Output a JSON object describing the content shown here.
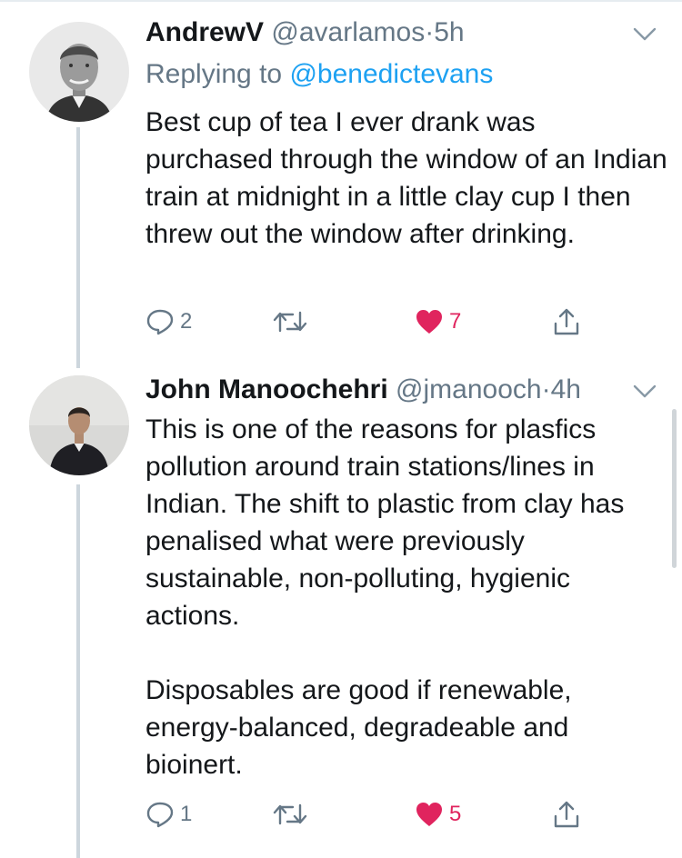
{
  "tweets": [
    {
      "display_name": "AndrewV",
      "handle": "@avarlamos",
      "separator": "·",
      "time": "5h",
      "replying_prefix": "Replying to ",
      "replying_to": "@benedictevans",
      "paragraphs": [
        "Best cup of tea I ever drank was purchased through the window of an Indian train at midnight in a little clay cup I then threw out the window after drinking."
      ],
      "replies": "2",
      "retweets": "",
      "likes": "7",
      "liked": true
    },
    {
      "display_name": "John Manoochehri",
      "handle": "@jmanooch",
      "separator": "·",
      "time": "4h",
      "paragraphs": [
        "This is one of the reasons for plasfics pollution around train stations/lines in Indian. The shift to plastic from clay has penalised what were previously sustainable, non-polluting, hygienic actions.",
        "Disposables are good if renewable, energy-balanced, degradeable and bioinert."
      ],
      "replies": "1",
      "retweets": "",
      "likes": "5",
      "liked": true
    }
  ],
  "icons": {
    "reply": "reply-icon",
    "retweet": "retweet-icon",
    "like": "heart-icon",
    "share": "share-icon",
    "more": "chevron-down-icon"
  },
  "colors": {
    "text": "#14171a",
    "secondary": "#657786",
    "link": "#1da1f2",
    "like": "#e0245e",
    "thread_line": "#cdd6dd"
  }
}
